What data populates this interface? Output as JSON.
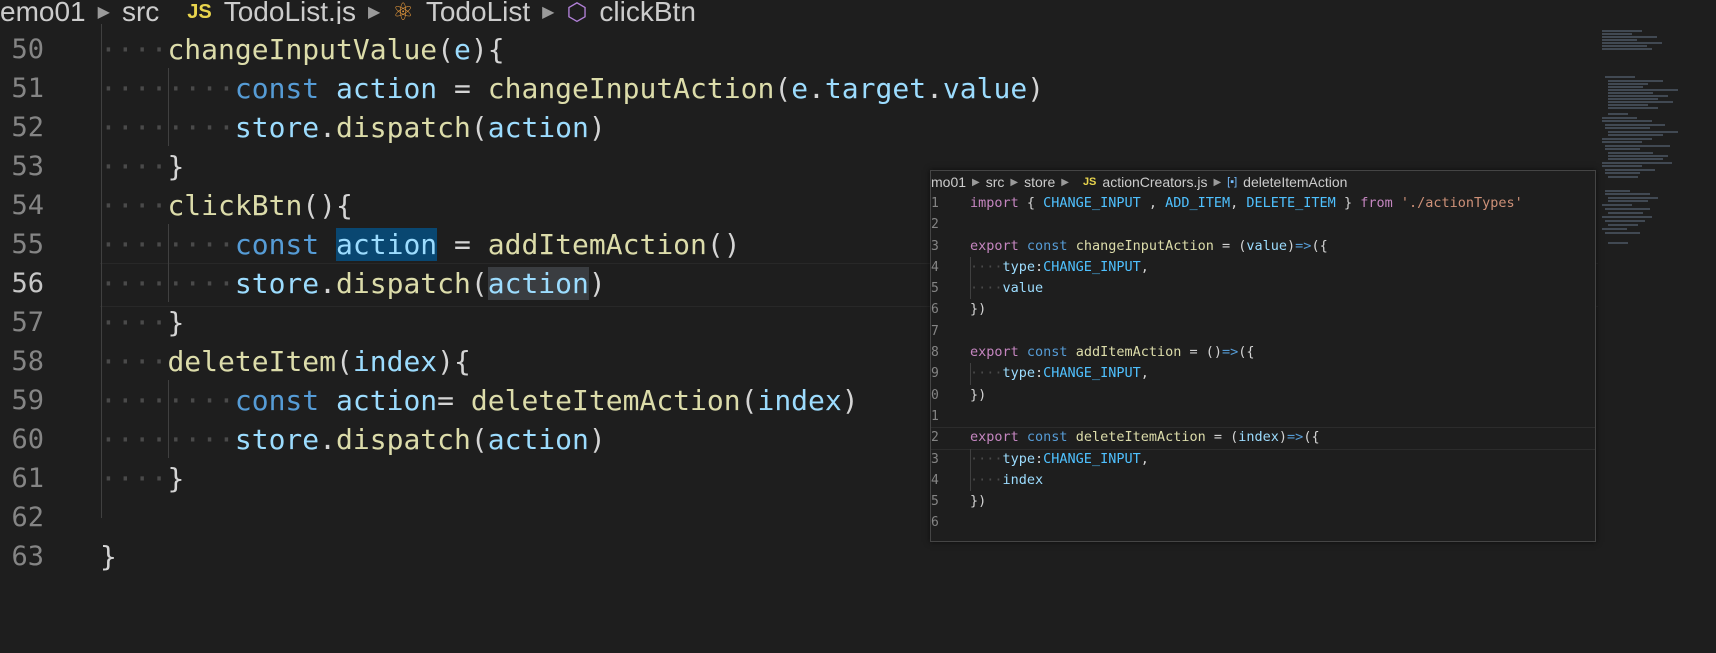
{
  "breadcrumb": {
    "segments": [
      "emo01",
      "src"
    ],
    "js_badge": "JS",
    "file": "TodoList.js",
    "class_name": "TodoList",
    "method": "clickBtn"
  },
  "editor": {
    "lines": [
      {
        "n": "50",
        "indent": 1,
        "tokens": [
          [
            "fn",
            "changeInputValue"
          ],
          [
            "pun",
            "("
          ],
          [
            "var",
            "e"
          ],
          [
            "pun",
            "){"
          ]
        ]
      },
      {
        "n": "51",
        "indent": 2,
        "tokens": [
          [
            "kw",
            "const"
          ],
          [
            "pun",
            " "
          ],
          [
            "var",
            "action"
          ],
          [
            "pun",
            " = "
          ],
          [
            "fn",
            "changeInputAction"
          ],
          [
            "pun",
            "("
          ],
          [
            "var",
            "e"
          ],
          [
            "pun",
            "."
          ],
          [
            "var",
            "target"
          ],
          [
            "pun",
            "."
          ],
          [
            "var",
            "value"
          ],
          [
            "pun",
            ")"
          ]
        ]
      },
      {
        "n": "52",
        "indent": 2,
        "tokens": [
          [
            "var",
            "store"
          ],
          [
            "pun",
            "."
          ],
          [
            "fn",
            "dispatch"
          ],
          [
            "pun",
            "("
          ],
          [
            "var",
            "action"
          ],
          [
            "pun",
            ")"
          ]
        ]
      },
      {
        "n": "53",
        "indent": 1,
        "tokens": [
          [
            "pun",
            "}"
          ]
        ]
      },
      {
        "n": "54",
        "indent": 1,
        "tokens": [
          [
            "fn",
            "clickBtn"
          ],
          [
            "pun",
            "(){"
          ]
        ]
      },
      {
        "n": "55",
        "indent": 2,
        "tokens": [
          [
            "kw",
            "const"
          ],
          [
            "pun",
            " "
          ],
          [
            "var hl1",
            "action"
          ],
          [
            "pun",
            " = "
          ],
          [
            "fn",
            "addItemAction"
          ],
          [
            "pun",
            "()"
          ]
        ]
      },
      {
        "n": "56",
        "indent": 2,
        "tokens": [
          [
            "var",
            "store"
          ],
          [
            "pun",
            "."
          ],
          [
            "fn",
            "dispatch"
          ],
          [
            "pun",
            "("
          ],
          [
            "var hl2",
            "action"
          ],
          [
            "pun",
            ")"
          ]
        ]
      },
      {
        "n": "57",
        "indent": 1,
        "tokens": [
          [
            "pun",
            "}"
          ]
        ]
      },
      {
        "n": "58",
        "indent": 1,
        "tokens": [
          [
            "fn",
            "deleteItem"
          ],
          [
            "pun",
            "("
          ],
          [
            "var",
            "index"
          ],
          [
            "pun",
            "){"
          ]
        ]
      },
      {
        "n": "59",
        "indent": 2,
        "tokens": [
          [
            "kw",
            "const"
          ],
          [
            "pun",
            " "
          ],
          [
            "var",
            "action"
          ],
          [
            "pun",
            "= "
          ],
          [
            "fn",
            "deleteItemAction"
          ],
          [
            "pun",
            "("
          ],
          [
            "var",
            "index"
          ],
          [
            "pun",
            ")"
          ]
        ]
      },
      {
        "n": "60",
        "indent": 2,
        "tokens": [
          [
            "var",
            "store"
          ],
          [
            "pun",
            "."
          ],
          [
            "fn",
            "dispatch"
          ],
          [
            "pun",
            "("
          ],
          [
            "var",
            "action"
          ],
          [
            "pun",
            ")"
          ]
        ]
      },
      {
        "n": "61",
        "indent": 1,
        "tokens": [
          [
            "pun",
            "}"
          ]
        ]
      },
      {
        "n": "62",
        "indent": 0,
        "tokens": []
      },
      {
        "n": "63",
        "indent": 0,
        "tokens": [
          [
            "pun",
            "}"
          ]
        ]
      }
    ],
    "active_line": "56"
  },
  "popup": {
    "breadcrumb": {
      "segments": [
        "mo01",
        "src",
        "store"
      ],
      "js_badge": "JS",
      "file": "actionCreators.js",
      "symbol": "deleteItemAction"
    },
    "lines": [
      {
        "n": "1",
        "indent": 0,
        "tokens": [
          [
            "kw2",
            "import"
          ],
          [
            "pun",
            " { "
          ],
          [
            "const",
            "CHANGE_INPUT"
          ],
          [
            "pun",
            " , "
          ],
          [
            "const",
            "ADD_ITEM"
          ],
          [
            "pun",
            ", "
          ],
          [
            "const",
            "DELETE_ITEM"
          ],
          [
            "pun",
            " } "
          ],
          [
            "kw2",
            "from"
          ],
          [
            "pun",
            " "
          ],
          [
            "str",
            "'./actionTypes'"
          ]
        ]
      },
      {
        "n": "2",
        "indent": 0,
        "tokens": []
      },
      {
        "n": "3",
        "indent": 0,
        "tokens": [
          [
            "kw2",
            "export"
          ],
          [
            "pun",
            " "
          ],
          [
            "kw",
            "const"
          ],
          [
            "pun",
            " "
          ],
          [
            "fn",
            "changeInputAction"
          ],
          [
            "pun",
            " = ("
          ],
          [
            "var",
            "value"
          ],
          [
            "pun",
            ")"
          ],
          [
            "kw",
            "=>"
          ],
          [
            "pun",
            "({"
          ]
        ]
      },
      {
        "n": "4",
        "indent": 1,
        "tokens": [
          [
            "var",
            "type"
          ],
          [
            "pun",
            ":"
          ],
          [
            "const",
            "CHANGE_INPUT"
          ],
          [
            "pun",
            ","
          ]
        ]
      },
      {
        "n": "5",
        "indent": 1,
        "tokens": [
          [
            "var",
            "value"
          ]
        ]
      },
      {
        "n": "6",
        "indent": 0,
        "tokens": [
          [
            "pun",
            "})"
          ]
        ]
      },
      {
        "n": "7",
        "indent": 0,
        "tokens": []
      },
      {
        "n": "8",
        "indent": 0,
        "tokens": [
          [
            "kw2",
            "export"
          ],
          [
            "pun",
            " "
          ],
          [
            "kw",
            "const"
          ],
          [
            "pun",
            " "
          ],
          [
            "fn",
            "addItemAction"
          ],
          [
            "pun",
            " = ()"
          ],
          [
            "kw",
            "=>"
          ],
          [
            "pun",
            "({"
          ]
        ]
      },
      {
        "n": "9",
        "indent": 1,
        "tokens": [
          [
            "var",
            "type"
          ],
          [
            "pun",
            ":"
          ],
          [
            "const",
            "CHANGE_INPUT"
          ],
          [
            "pun",
            ","
          ]
        ]
      },
      {
        "n": "0",
        "indent": 0,
        "tokens": [
          [
            "pun",
            "})"
          ]
        ]
      },
      {
        "n": "1",
        "indent": 0,
        "tokens": []
      },
      {
        "n": "2",
        "indent": 0,
        "tokens": [
          [
            "kw2",
            "export"
          ],
          [
            "pun",
            " "
          ],
          [
            "kw",
            "const"
          ],
          [
            "pun",
            " "
          ],
          [
            "fn",
            "deleteItemAction"
          ],
          [
            "pun",
            " = ("
          ],
          [
            "var",
            "index"
          ],
          [
            "pun",
            ")"
          ],
          [
            "kw",
            "=>"
          ],
          [
            "pun",
            "({"
          ]
        ]
      },
      {
        "n": "3",
        "indent": 1,
        "tokens": [
          [
            "var",
            "type"
          ],
          [
            "pun",
            ":"
          ],
          [
            "const",
            "CHANGE_INPUT"
          ],
          [
            "pun",
            ","
          ]
        ]
      },
      {
        "n": "4",
        "indent": 1,
        "tokens": [
          [
            "var",
            "index"
          ]
        ]
      },
      {
        "n": "5",
        "indent": 0,
        "tokens": [
          [
            "pun",
            "})"
          ]
        ]
      },
      {
        "n": "6",
        "indent": 0,
        "tokens": []
      }
    ],
    "active_line_index": 11
  },
  "colors": {
    "background": "#1e1e1e",
    "function": "#dcdcaa",
    "keyword": "#569cd6",
    "variable": "#9cdcfe",
    "import_keyword": "#c586c0",
    "constant": "#4fc1ff",
    "string": "#ce9178",
    "selection": "#094771"
  }
}
